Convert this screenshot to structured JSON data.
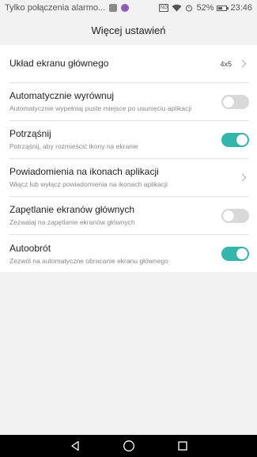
{
  "status_bar": {
    "carrier_text": "Tylko połączenia alarmo...",
    "sim_label": "NO",
    "battery_percent": "52%",
    "battery_level": 0.52,
    "time": "23:46"
  },
  "header": {
    "title": "Więcej ustawień"
  },
  "settings": [
    {
      "title": "Układ ekranu głównego",
      "subtitle": "",
      "value": "4x5",
      "control": "chevron"
    },
    {
      "title": "Automatycznie wyrównuj",
      "subtitle": "Automatycznie wypełniaj puste miejsce po usunięciu aplikacji",
      "control": "toggle",
      "enabled": false
    },
    {
      "title": "Potrząśnij",
      "subtitle": "Potrząśnij, aby rozmieścić ikony na ekranie",
      "control": "toggle",
      "enabled": true
    },
    {
      "title": "Powiadomienia na ikonach aplikacji",
      "subtitle": "Włącz lub wyłącz powiadomienia na ikonach aplikacji",
      "control": "chevron"
    },
    {
      "title": "Zapętlanie ekranów głównych",
      "subtitle": "Zezwalaj na zapętlanie ekranów głównych",
      "control": "toggle",
      "enabled": false
    },
    {
      "title": "Autoobrót",
      "subtitle": "Zezwól na automatyczne obracanie ekranu głównego",
      "control": "toggle",
      "enabled": true
    }
  ],
  "colors": {
    "toggle_on": "#35b6ab",
    "toggle_off": "#d9d9d9",
    "background": "#f2f2f2"
  },
  "nav_bar": {
    "icons": [
      "back-icon",
      "home-icon",
      "recents-icon"
    ]
  }
}
